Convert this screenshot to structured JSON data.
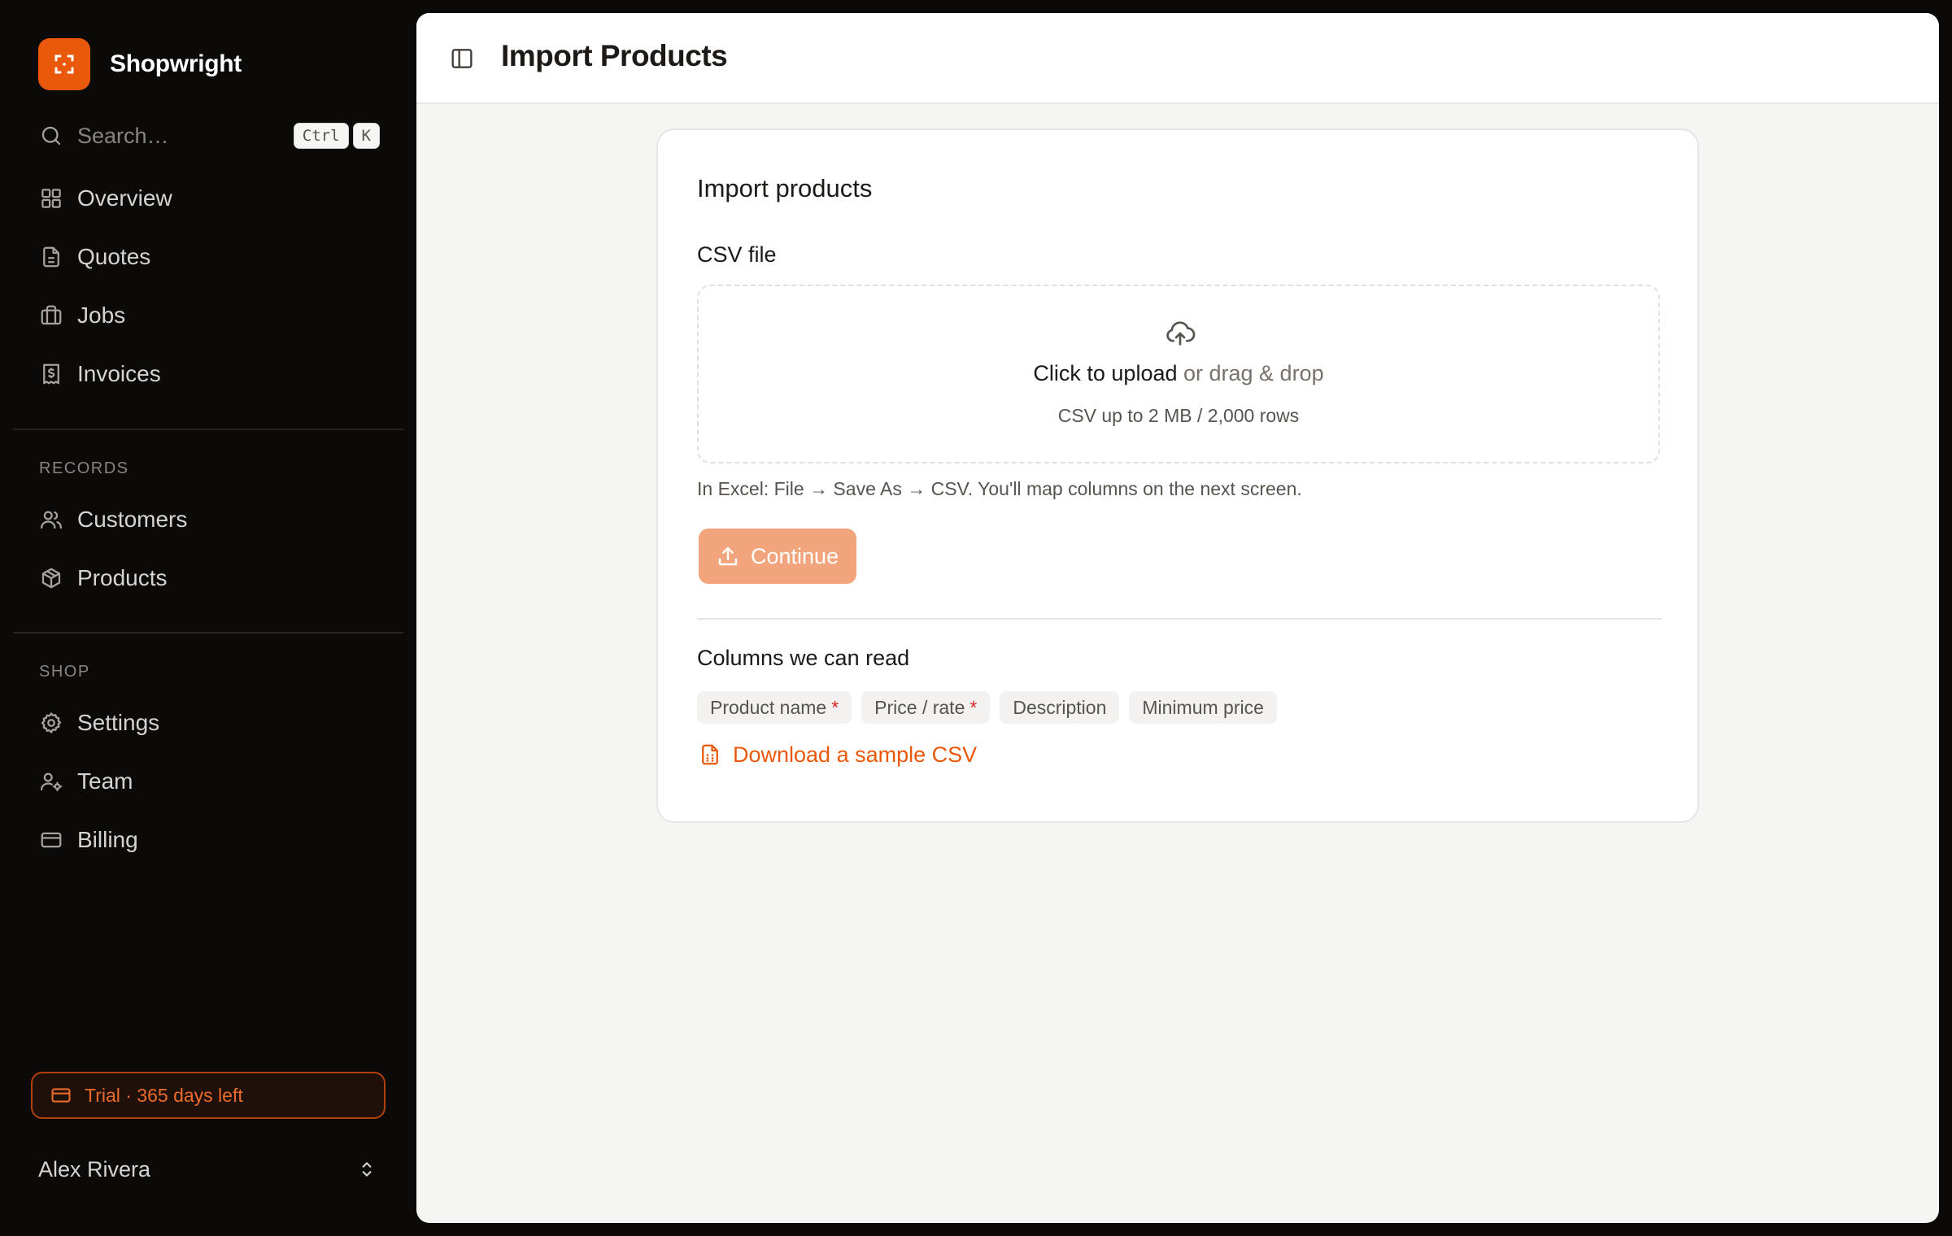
{
  "app": {
    "name": "Shopwright"
  },
  "search": {
    "placeholder": "Search…",
    "shortcut": [
      "Ctrl",
      "K"
    ]
  },
  "nav": {
    "main": [
      {
        "label": "Overview",
        "icon": "grid-icon"
      },
      {
        "label": "Quotes",
        "icon": "document-icon"
      },
      {
        "label": "Jobs",
        "icon": "briefcase-icon"
      },
      {
        "label": "Invoices",
        "icon": "receipt-dollar-icon"
      }
    ],
    "records_title": "RECORDS",
    "records": [
      {
        "label": "Customers",
        "icon": "users-icon"
      },
      {
        "label": "Products",
        "icon": "box-icon"
      }
    ],
    "shop_title": "SHOP",
    "shop": [
      {
        "label": "Settings",
        "icon": "gear-icon"
      },
      {
        "label": "Team",
        "icon": "user-cog-icon"
      },
      {
        "label": "Billing",
        "icon": "credit-card-icon"
      }
    ]
  },
  "trial": {
    "label": "Trial · 365 days left"
  },
  "user": {
    "name": "Alex Rivera"
  },
  "header": {
    "title": "Import Products"
  },
  "card": {
    "title": "Import products",
    "file_label": "CSV file",
    "dropzone": {
      "action": "Click to upload",
      "alt": " or drag & drop",
      "hint": "CSV up to 2 MB / 2,000 rows"
    },
    "help": "In Excel: File → Save As → CSV. You'll map columns on the next screen.",
    "continue_label": "Continue",
    "columns_title": "Columns we can read",
    "columns": [
      {
        "label": "Product name",
        "required": "*"
      },
      {
        "label": "Price / rate",
        "required": "*"
      },
      {
        "label": "Description",
        "required": ""
      },
      {
        "label": "Minimum price",
        "required": ""
      }
    ],
    "sample_label": "Download a sample CSV"
  },
  "colors": {
    "accent": "#ea580c",
    "sidebar_bg": "#0c0a09",
    "main_bg": "#f5f5f4",
    "required": "#dc2626"
  }
}
